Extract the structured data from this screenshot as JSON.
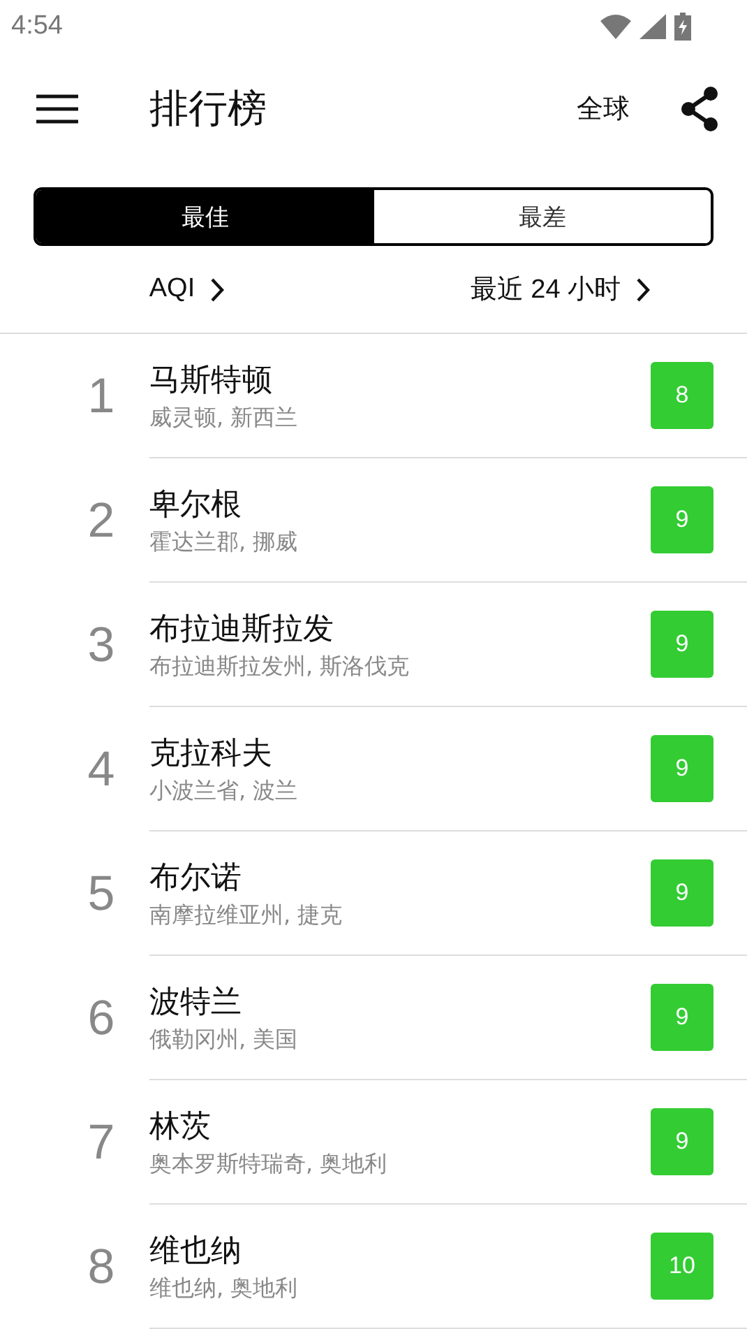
{
  "status_bar": {
    "time": "4:54"
  },
  "app_bar": {
    "title": "排行榜",
    "region": "全球"
  },
  "tabs": [
    {
      "label": "最佳",
      "selected": true
    },
    {
      "label": "最差",
      "selected": false
    }
  ],
  "filters": [
    {
      "label": "AQI"
    },
    {
      "label": "最近 24 小时"
    }
  ],
  "rankings": [
    {
      "rank": "1",
      "city": "马斯特顿",
      "location": "威灵顿, 新西兰",
      "aqi": "8",
      "color": "#33cc33"
    },
    {
      "rank": "2",
      "city": "卑尔根",
      "location": "霍达兰郡, 挪威",
      "aqi": "9",
      "color": "#33cc33"
    },
    {
      "rank": "3",
      "city": "布拉迪斯拉发",
      "location": "布拉迪斯拉发州, 斯洛伐克",
      "aqi": "9",
      "color": "#33cc33"
    },
    {
      "rank": "4",
      "city": "克拉科夫",
      "location": "小波兰省, 波兰",
      "aqi": "9",
      "color": "#33cc33"
    },
    {
      "rank": "5",
      "city": "布尔诺",
      "location": "南摩拉维亚州, 捷克",
      "aqi": "9",
      "color": "#33cc33"
    },
    {
      "rank": "6",
      "city": "波特兰",
      "location": "俄勒冈州, 美国",
      "aqi": "9",
      "color": "#33cc33"
    },
    {
      "rank": "7",
      "city": "林茨",
      "location": "奥本罗斯特瑞奇, 奥地利",
      "aqi": "9",
      "color": "#33cc33"
    },
    {
      "rank": "8",
      "city": "维也纳",
      "location": "维也纳, 奥地利",
      "aqi": "10",
      "color": "#33cc33"
    }
  ]
}
